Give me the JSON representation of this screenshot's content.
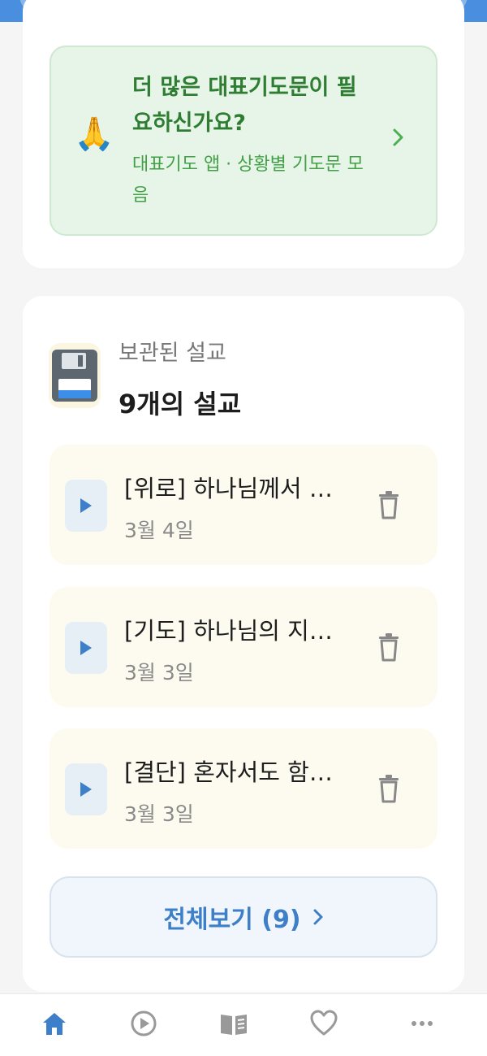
{
  "promo": {
    "emoji": "🙏",
    "title": "더 많은 대표기도문이 필요하신가요?",
    "subtitle": "대표기도 앱 · 상황별 기도문 모음",
    "chevron_icon": "chevron-right-icon",
    "colors": {
      "background": "#e6f5e7",
      "title": "#2e7d32",
      "subtitle": "#43a047"
    }
  },
  "saved": {
    "label": "보관된 설교",
    "count_text": "9개의 설교",
    "icon": "floppy-disk-icon",
    "items": [
      {
        "title": "[위로] 하나님께서 …",
        "date": "3월 4일"
      },
      {
        "title": "[기도] 하나님의 지…",
        "date": "3월 3일"
      },
      {
        "title": "[결단] 혼자서도 함…",
        "date": "3월 3일"
      }
    ],
    "view_all_label": "전체보기 (9)"
  },
  "bottom_nav": {
    "items": [
      {
        "icon": "home-icon",
        "active": true
      },
      {
        "icon": "play-circle-icon",
        "active": false
      },
      {
        "icon": "book-icon",
        "active": false
      },
      {
        "icon": "heart-icon",
        "active": false
      },
      {
        "icon": "more-icon",
        "active": false
      }
    ]
  },
  "colors": {
    "accent": "#4a8fdf",
    "link": "#3d7fc8"
  }
}
